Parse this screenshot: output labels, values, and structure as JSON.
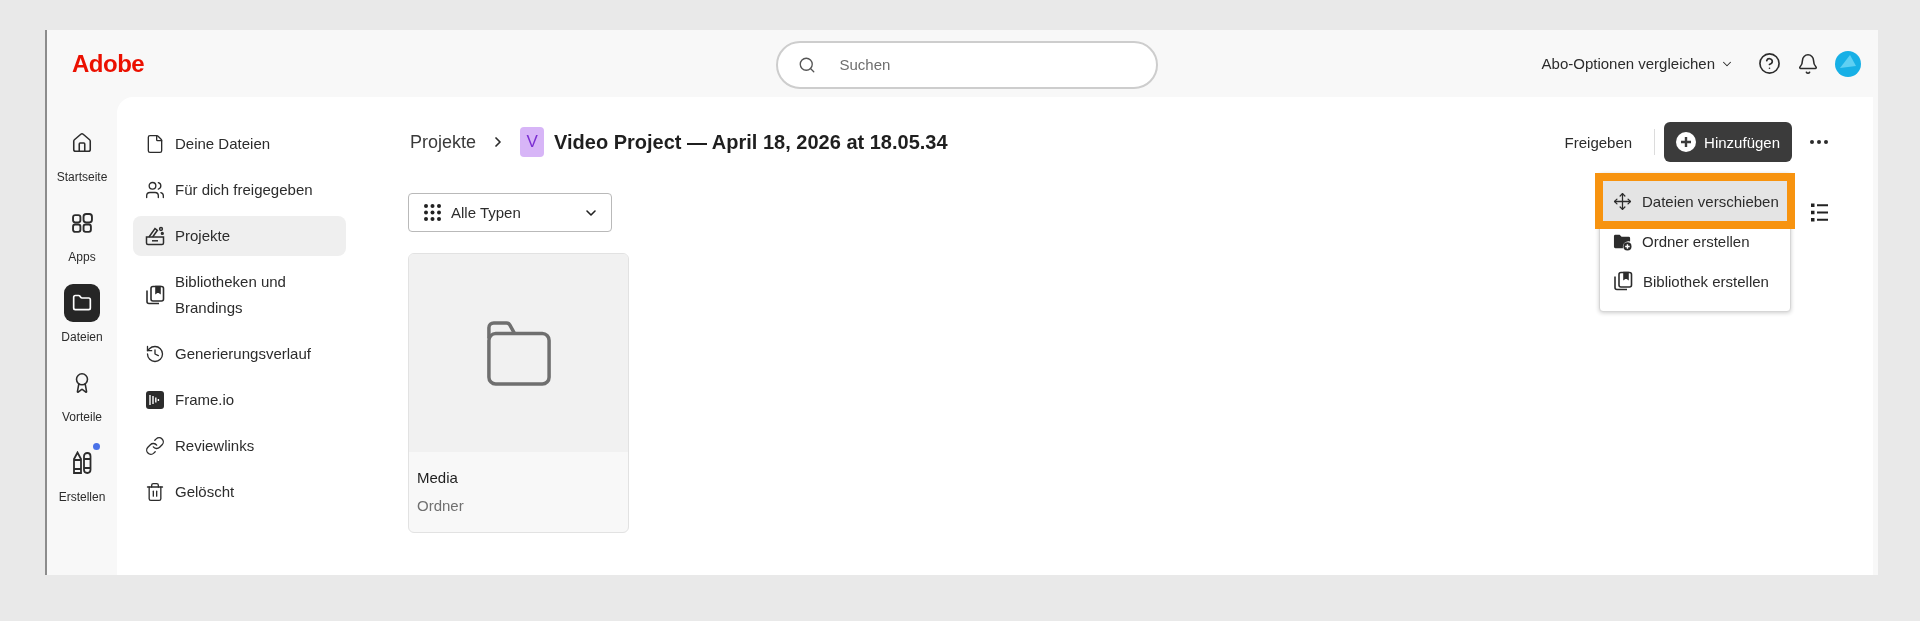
{
  "header": {
    "logo": "Adobe",
    "search": {
      "placeholder": "Suchen"
    },
    "plans_menu": "Abo-Optionen vergleichen"
  },
  "rail": {
    "items": [
      {
        "label": "Startseite",
        "selected": false,
        "notification": false
      },
      {
        "label": "Apps",
        "selected": false,
        "notification": false
      },
      {
        "label": "Dateien",
        "selected": true,
        "notification": false
      },
      {
        "label": "Vorteile",
        "selected": false,
        "notification": false
      },
      {
        "label": "Erstellen",
        "selected": false,
        "notification": true
      }
    ]
  },
  "sidebar": {
    "items": [
      {
        "label": "Deine Dateien",
        "selected": false
      },
      {
        "label": "Für dich freigegeben",
        "selected": false
      },
      {
        "label": "Projekte",
        "selected": true
      },
      {
        "label": "Bibliotheken und Brandings",
        "selected": false
      },
      {
        "label": "Generierungsverlauf",
        "selected": false
      },
      {
        "label": "Frame.io",
        "selected": false
      },
      {
        "label": "Reviewlinks",
        "selected": false
      },
      {
        "label": "Gelöscht",
        "selected": false
      }
    ]
  },
  "breadcrumb": {
    "parent": "Projekte",
    "badge": "V",
    "title": "Video Project — April 18, 2026 at 18.05.34"
  },
  "actions": {
    "share": "Freigeben",
    "add": "Hinzufügen"
  },
  "add_menu": {
    "open": true,
    "items": [
      {
        "label": "Dateien verschieben",
        "highlighted": true
      },
      {
        "label": "Ordner erstellen",
        "highlighted": false
      },
      {
        "label": "Bibliothek erstellen",
        "highlighted": false
      }
    ]
  },
  "filter": {
    "value": "Alle Typen"
  },
  "files": [
    {
      "name": "Media",
      "type": "Ordner"
    }
  ]
}
